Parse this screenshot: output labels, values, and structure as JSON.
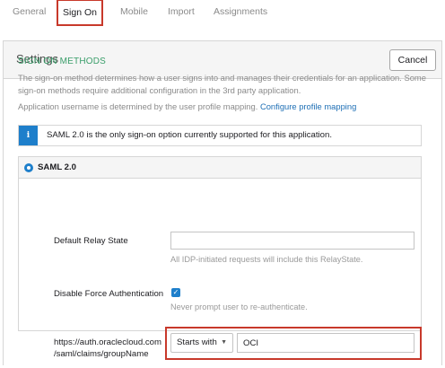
{
  "tabs": [
    {
      "label": "General"
    },
    {
      "label": "Sign On"
    },
    {
      "label": "Mobile"
    },
    {
      "label": "Import"
    },
    {
      "label": "Assignments"
    }
  ],
  "settings": {
    "title": "Settings",
    "cancel_label": "Cancel"
  },
  "sign_on": {
    "section_title": "SIGN ON METHODS",
    "description": "The sign-on method determines how a user signs into and manages their credentials for an application. Some sign-on methods require additional configuration in the 3rd party application.",
    "username_text": "Application username is determined by the user profile mapping.",
    "profile_link": "Configure profile mapping",
    "info_text": "SAML 2.0 is the only sign-on option currently supported for this application.",
    "info_icon": "info-icon"
  },
  "saml": {
    "label": "SAML 2.0",
    "relay_state_label": "Default Relay State",
    "relay_state_value": "",
    "relay_state_hint": "All IDP-initiated requests will include this RelayState.",
    "disable_force_label": "Disable Force Authentication",
    "disable_force_checked": true,
    "disable_force_hint": "Never prompt user to re-authenticate.",
    "claim_label_line1": "https://auth.oraclecloud.com",
    "claim_label_line2": "/saml/claims/groupName",
    "claim_match": "Starts with",
    "claim_value": "OCI"
  },
  "colors": {
    "accent": "#1e7fcb",
    "highlight": "#c8392b",
    "section_title": "#3a9e6a"
  }
}
